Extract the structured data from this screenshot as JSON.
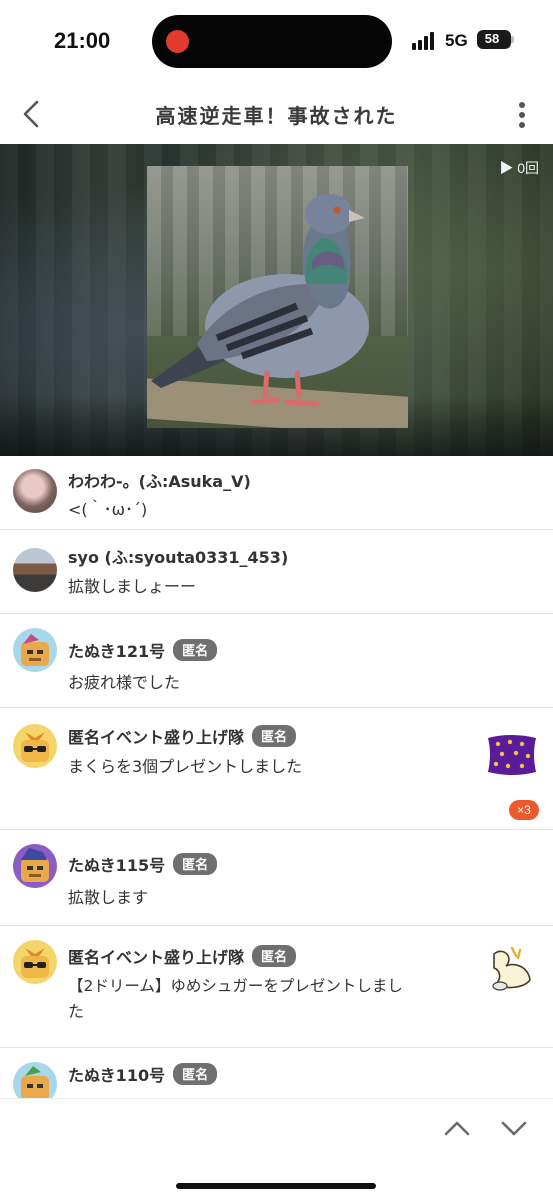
{
  "status": {
    "time": "21:00",
    "network": "5G",
    "battery": "58",
    "battery_level": 0.58
  },
  "header": {
    "title": "高速逆走車！事故された",
    "back_icon": "chevron-left-icon",
    "menu_icon": "vertical-dots-icon"
  },
  "video": {
    "view_count": "▶ 0回"
  },
  "comments": [
    {
      "user": "わわわ-。(ふ:Asuka_V)",
      "badge": "",
      "text": "<(｀･ω･´)"
    },
    {
      "user": "syo (ふ:syouta0331_453)",
      "badge": "",
      "text": "拡散しましょーー"
    },
    {
      "user": "たぬき121号",
      "badge": "匿名",
      "text": "お疲れ様でした"
    },
    {
      "user": "匿名イベント盛り上げ隊",
      "badge": "匿名",
      "text": "まくらを3個プレゼントしました",
      "gift": "pillow-gift-icon",
      "gift_count": "×3"
    },
    {
      "user": "たぬき115号",
      "badge": "匿名",
      "text": "拡散します"
    },
    {
      "user": "匿名イベント盛り上げ隊",
      "badge": "匿名",
      "text_line1": "【2ドリーム】ゆめシュガーをプレゼントしまし",
      "text_line2": "た",
      "gift": "dream-sugar-gift-icon"
    },
    {
      "user": "たぬき110号",
      "badge": "匿名"
    }
  ],
  "colors": {
    "accent": "#ea5a2a",
    "badge": "#6f6f6f",
    "divider": "#e6e6e6"
  }
}
